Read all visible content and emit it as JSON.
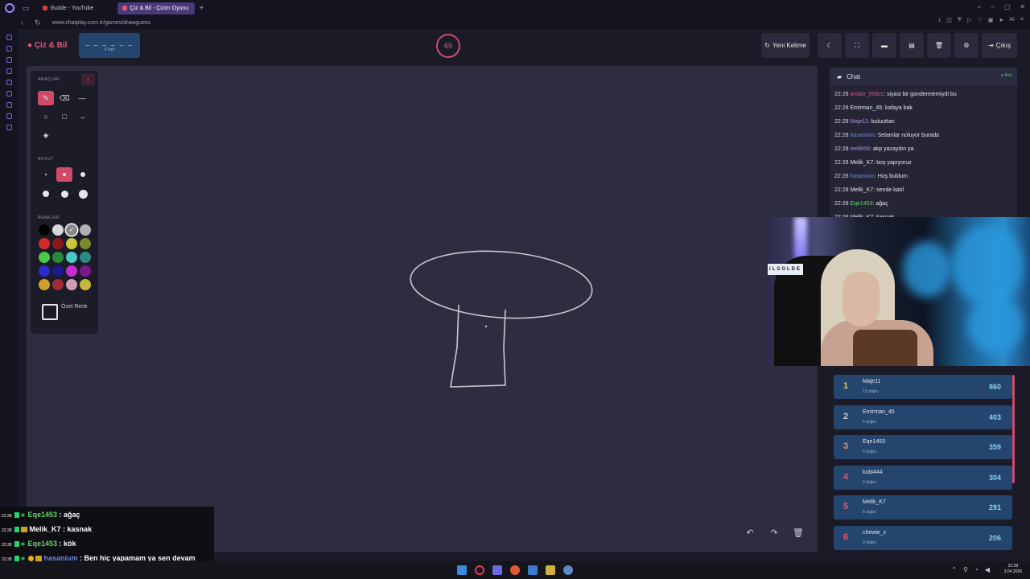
{
  "browser": {
    "tabs": [
      {
        "label": "Ilsolde - YouTube",
        "color": "#e23b3b"
      },
      {
        "label": "Çiz & Bil - Çizim Oyunu",
        "color": "#e0567a"
      }
    ],
    "url": "www.chatplay.com.tr/games/drawguess"
  },
  "app": {
    "brand": "Çiz & Bil",
    "word_mask": "_ _ _ _ _ _",
    "word_hint": "6 harf",
    "timer": "69",
    "buttons": {
      "new_word": "Yeni Kelime",
      "exit": "Çıkış"
    }
  },
  "toolbar": {
    "tools_label": "ARAÇLAR",
    "size_label": "BOYUT",
    "colors_label": "RENKLER",
    "custom_color_label": "Özel Renk",
    "tools": [
      {
        "icon": "pencil-icon",
        "glyph": "✎",
        "selected": true
      },
      {
        "icon": "eraser-icon",
        "glyph": "⌫",
        "selected": false
      },
      {
        "icon": "line-icon",
        "glyph": "—",
        "selected": false
      },
      {
        "icon": "circle-icon",
        "glyph": "○",
        "selected": false
      },
      {
        "icon": "rectangle-icon",
        "glyph": "□",
        "selected": false
      },
      {
        "icon": "arrow-icon",
        "glyph": "→",
        "selected": false
      },
      {
        "icon": "fill-bucket-icon",
        "glyph": "◈",
        "selected": false
      }
    ],
    "sizes": [
      {
        "level": 1,
        "selected": false
      },
      {
        "level": 2,
        "selected": true
      },
      {
        "level": 3,
        "selected": false
      },
      {
        "level": 4,
        "selected": false
      },
      {
        "level": 5,
        "selected": false
      },
      {
        "level": 6,
        "selected": false
      }
    ],
    "colors": [
      "#000000",
      "#d8d8d8",
      "#888888",
      "#b0b0b0",
      "#d42a2a",
      "#8a1a1a",
      "#c8c83a",
      "#7a8a2a",
      "#4ac84a",
      "#2a8a3a",
      "#4ac8c8",
      "#2a8a8a",
      "#2a2ad0",
      "#1a1a8a",
      "#c82ad0",
      "#7a1a8a",
      "#d0a02a",
      "#a02a3a",
      "#d0a0b0",
      "#c8b83a"
    ],
    "selected_color_index": 2
  },
  "chat": {
    "title": "Chat",
    "status": "Kick",
    "messages": [
      {
        "time": "22:28",
        "user": "arslan_999cc",
        "user_color": "#e0567a",
        "text": ": siyasi bir gondermemiydi bu"
      },
      {
        "time": "22:28",
        "user": "Emirman_45",
        "user_color": "#e6e6ee",
        "text": ": kafaya bak"
      },
      {
        "time": "22:28",
        "user": "Maje11",
        "user_color": "#b08ae8",
        "text": ": buluuttan"
      },
      {
        "time": "22:28",
        "user": "hasanium",
        "user_color": "#6a8ae0",
        "text": ": Selamlar noluyor burada"
      },
      {
        "time": "22:28",
        "user": "melih56",
        "user_color": "#b08ae8",
        "text": ": akp yazaydın ya"
      },
      {
        "time": "22:28",
        "user": "Melik_K7",
        "user_color": "#e6e6ee",
        "text": ": boş yapıyoruz"
      },
      {
        "time": "22:28",
        "user": "hasanium",
        "user_color": "#6a8ae0",
        "text": ": Hoş buldum"
      },
      {
        "time": "22:28",
        "user": "Melik_K7",
        "user_color": "#e6e6ee",
        "text": ": sende katıl"
      },
      {
        "time": "22:28",
        "user": "Eqe1453",
        "user_color": "#6ad06a",
        "text": ": ağaç"
      },
      {
        "time": "22:28",
        "user": "Melik_K7",
        "user_color": "#e6e6ee",
        "text": ": kasnak"
      }
    ]
  },
  "webcam": {
    "sign": "ILSOLDE"
  },
  "leaderboard": [
    {
      "rank": "1",
      "name": "Maje11",
      "sub": "13 doğru",
      "score": "860",
      "rank_color": "#e8c84a"
    },
    {
      "rank": "2",
      "name": "Emirman_45",
      "sub": "5 doğru",
      "score": "403",
      "rank_color": "#c8c8d6"
    },
    {
      "rank": "3",
      "name": "Eqe1453",
      "sub": "5 doğru",
      "score": "359",
      "rank_color": "#e0904a"
    },
    {
      "rank": "4",
      "name": "kubi444",
      "sub": "4 doğru",
      "score": "304",
      "rank_color": "#e0567a"
    },
    {
      "rank": "5",
      "name": "Melik_K7",
      "sub": "5 doğru",
      "score": "291",
      "rank_color": "#e0567a"
    },
    {
      "rank": "6",
      "name": "chewie_z",
      "sub": "3 doğru",
      "score": "206",
      "rank_color": "#e0567a"
    }
  ],
  "overlay_chat": [
    {
      "time": "22:28",
      "user": "Eqe1453",
      "user_color": "#6ad06a",
      "text": " : ağaç",
      "badges": "g"
    },
    {
      "time": "22:28",
      "user": "Melik_K7",
      "user_color": "#ffffff",
      "text": " : kasnak",
      "badges": "s"
    },
    {
      "time": "22:28",
      "user": "Eqe1453",
      "user_color": "#6ad06a",
      "text": " : kök",
      "badges": "g"
    },
    {
      "time": "22:28",
      "user": "hasanium",
      "user_color": "#6a8ae0",
      "text": " : Ben hiç yapamam ya sen devam",
      "badges": "h"
    }
  ],
  "overlay_chat_wrap": "et",
  "taskbar": {
    "time": "22:28",
    "date": "3.04.2026"
  }
}
